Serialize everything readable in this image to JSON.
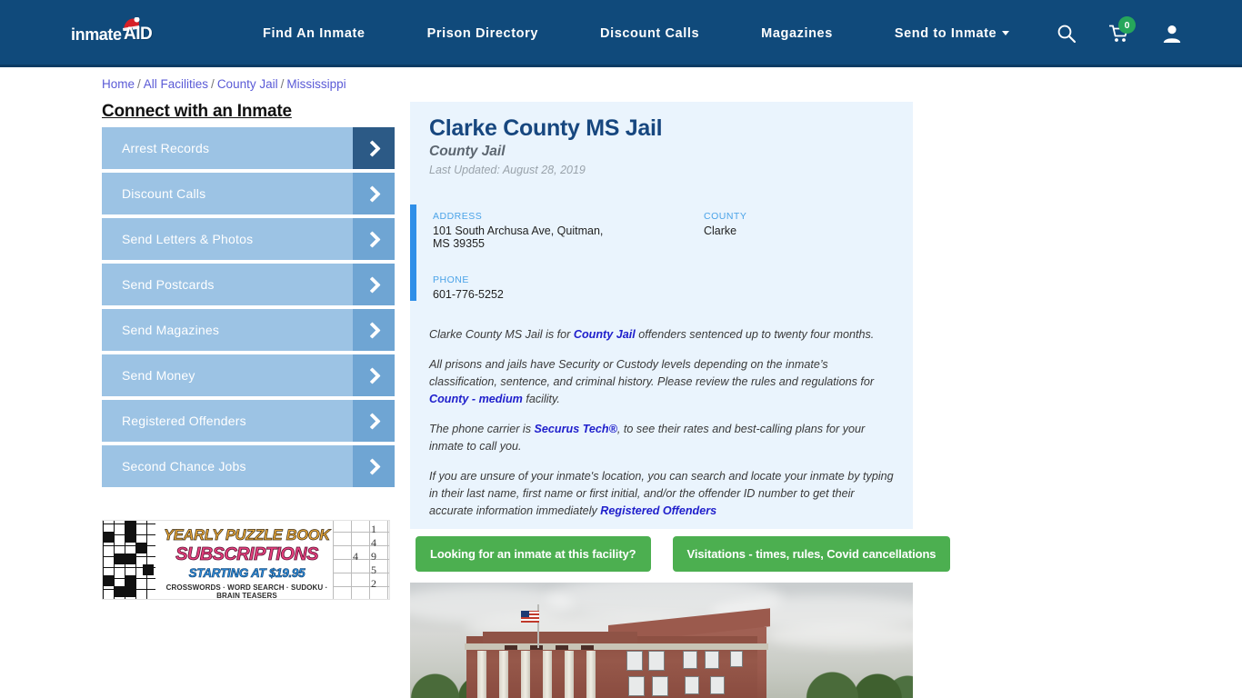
{
  "header": {
    "logo": {
      "word": "inmate",
      "aid": "AID",
      "hat_icon": "santa-hat-icon"
    },
    "nav_items": [
      {
        "label": "Find An Inmate",
        "has_caret": false
      },
      {
        "label": "Prison Directory",
        "has_caret": false
      },
      {
        "label": "Discount Calls",
        "has_caret": false
      },
      {
        "label": "Magazines",
        "has_caret": false
      },
      {
        "label": "Send to Inmate",
        "has_caret": true
      }
    ],
    "icons": {
      "search": "search-icon",
      "cart": "shopping-cart-icon",
      "cart_count": "0",
      "account": "user-account-icon"
    },
    "colors": {
      "bar": "#104a7b",
      "badge": "#26a65b"
    }
  },
  "breadcrumb": {
    "items": [
      "Home",
      "All Facilities",
      "County Jail",
      "Mississippi"
    ],
    "separator": "/"
  },
  "sidebar": {
    "title": "Connect with an Inmate",
    "items": [
      {
        "label": "Arrest Records",
        "active": true
      },
      {
        "label": "Discount Calls",
        "active": false
      },
      {
        "label": "Send Letters & Photos",
        "active": false
      },
      {
        "label": "Send Postcards",
        "active": false
      },
      {
        "label": "Send Magazines",
        "active": false
      },
      {
        "label": "Send Money",
        "active": false
      },
      {
        "label": "Registered Offenders",
        "active": false
      },
      {
        "label": "Second Chance Jobs",
        "active": false
      }
    ]
  },
  "ad": {
    "line1": "YEARLY PUZZLE BOOK",
    "line2": "SUBSCRIPTIONS",
    "line3": "STARTING AT $19.95",
    "line4": "CROSSWORDS · WORD SEARCH · SUDOKU · BRAIN TEASERS",
    "sudoku_numbers": [
      "1",
      "4",
      "4",
      "9",
      "5",
      "2"
    ]
  },
  "facility": {
    "title": "Clarke County MS Jail",
    "subtitle": "County Jail",
    "last_updated": "Last Updated: August 28, 2019",
    "info": {
      "address_label": "ADDRESS",
      "address_value": "101 South Archusa Ave, Quitman, MS 39355",
      "county_label": "COUNTY",
      "county_value": "Clarke",
      "phone_label": "PHONE",
      "phone_value": "601-776-5252"
    },
    "paragraphs": [
      {
        "parts": [
          {
            "t": "Clarke County MS Jail is for ",
            "link": false
          },
          {
            "t": "County Jail",
            "link": true
          },
          {
            "t": " offenders sentenced up to twenty four months.",
            "link": false
          }
        ]
      },
      {
        "parts": [
          {
            "t": "All prisons and jails have Security or Custody levels depending on the inmate’s classification, sentence, and criminal history. Please review the rules and regulations for ",
            "link": false
          },
          {
            "t": "County - medium",
            "link": true
          },
          {
            "t": " facility.",
            "link": false
          }
        ]
      },
      {
        "parts": [
          {
            "t": "The phone carrier is ",
            "link": false
          },
          {
            "t": "Securus Tech®",
            "link": true
          },
          {
            "t": ", to see their rates and best-calling plans for your inmate to call you.",
            "link": false
          }
        ]
      },
      {
        "parts": [
          {
            "t": "If you are unsure of your inmate's location, you can search and locate your inmate by typing in their last name, first name or first initial, and/or the offender ID number to get their accurate information immediately ",
            "link": false
          },
          {
            "t": "Registered Offenders",
            "link": true
          }
        ]
      }
    ]
  },
  "cta_buttons": [
    {
      "label": "Looking for an inmate at this facility?"
    },
    {
      "label": "Visitations - times, rules, Covid cancellations"
    }
  ],
  "photo": {
    "alt": "Clarke County courthouse brick building with American flag"
  },
  "colors": {
    "card_bg": "#eaf4fd",
    "accent_blue": "#2f8fe8",
    "title_blue": "#17477f",
    "green_button": "#4caf50",
    "sidebar_button": "#9cc3e4",
    "sidebar_arrow": "#6fa5d3",
    "sidebar_arrow_active": "#2c5a86",
    "link_blue": "#2020cc"
  }
}
